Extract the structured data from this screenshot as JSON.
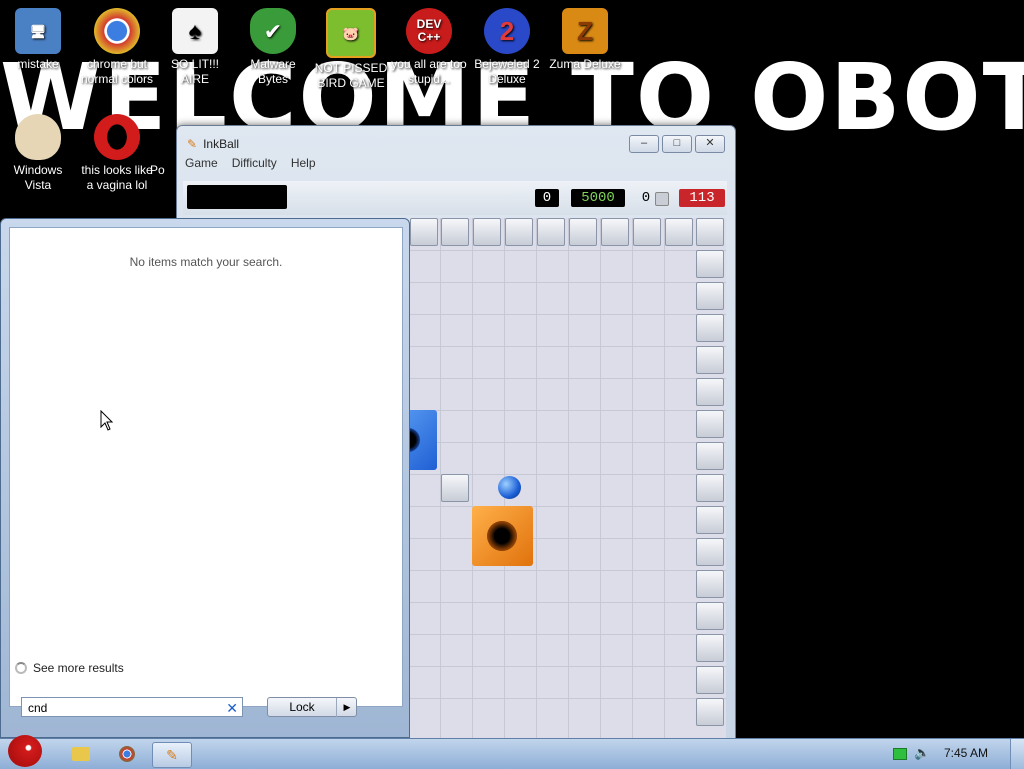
{
  "wallpaper": {
    "text": "WELCOME TO OBOT!"
  },
  "desktop_icons": [
    {
      "label": "mistake",
      "icon": "computer-icon",
      "color": "#4a80c4"
    },
    {
      "label": "chrome but normal colors",
      "icon": "chrome-icon",
      "color": "#2e9b48"
    },
    {
      "label": "SO LIT!!! AIRE",
      "icon": "solitaire-icon",
      "color": "#1e5c2b"
    },
    {
      "label": "Malware Bytes",
      "icon": "shield-icon",
      "color": "#3a9b3a"
    },
    {
      "label": "NOT PISSED BIRD GAME",
      "icon": "angry-bird-icon",
      "color": "#7dbe2f"
    },
    {
      "label": "you all are too stupid...",
      "icon": "devcpp-icon",
      "color": "#c81b1b"
    },
    {
      "label": "Bejeweled 2 Deluxe",
      "icon": "bejeweled-icon",
      "color": "#2a49c8"
    },
    {
      "label": "Zuma Deluxe",
      "icon": "zuma-icon",
      "color": "#d98a14"
    },
    {
      "label": "Windows Vista",
      "icon": "egg-icon",
      "color": "#e6d6b6"
    },
    {
      "label": "this looks like a vagina lol",
      "icon": "opera-icon",
      "color": "#d21b1b"
    },
    {
      "label": "Po",
      "icon": "generic-icon",
      "color": "#888888"
    }
  ],
  "inkball": {
    "title": "InkBall",
    "menu": [
      "Game",
      "Difficulty",
      "Help"
    ],
    "scores": {
      "left": "0",
      "points": "5000",
      "balls": "0",
      "timer": "113"
    }
  },
  "start_menu": {
    "no_items": "No items match your search.",
    "see_more": "See more results",
    "search_value": "cnd",
    "lock_label": "Lock"
  },
  "taskbar": {
    "clock": "7:45 AM"
  },
  "colors": {
    "accent_blue": "#1d5fc9",
    "hole_orange": "#f28a18",
    "hole_blue": "#2b6fe0",
    "timer_red": "#c8262a"
  }
}
